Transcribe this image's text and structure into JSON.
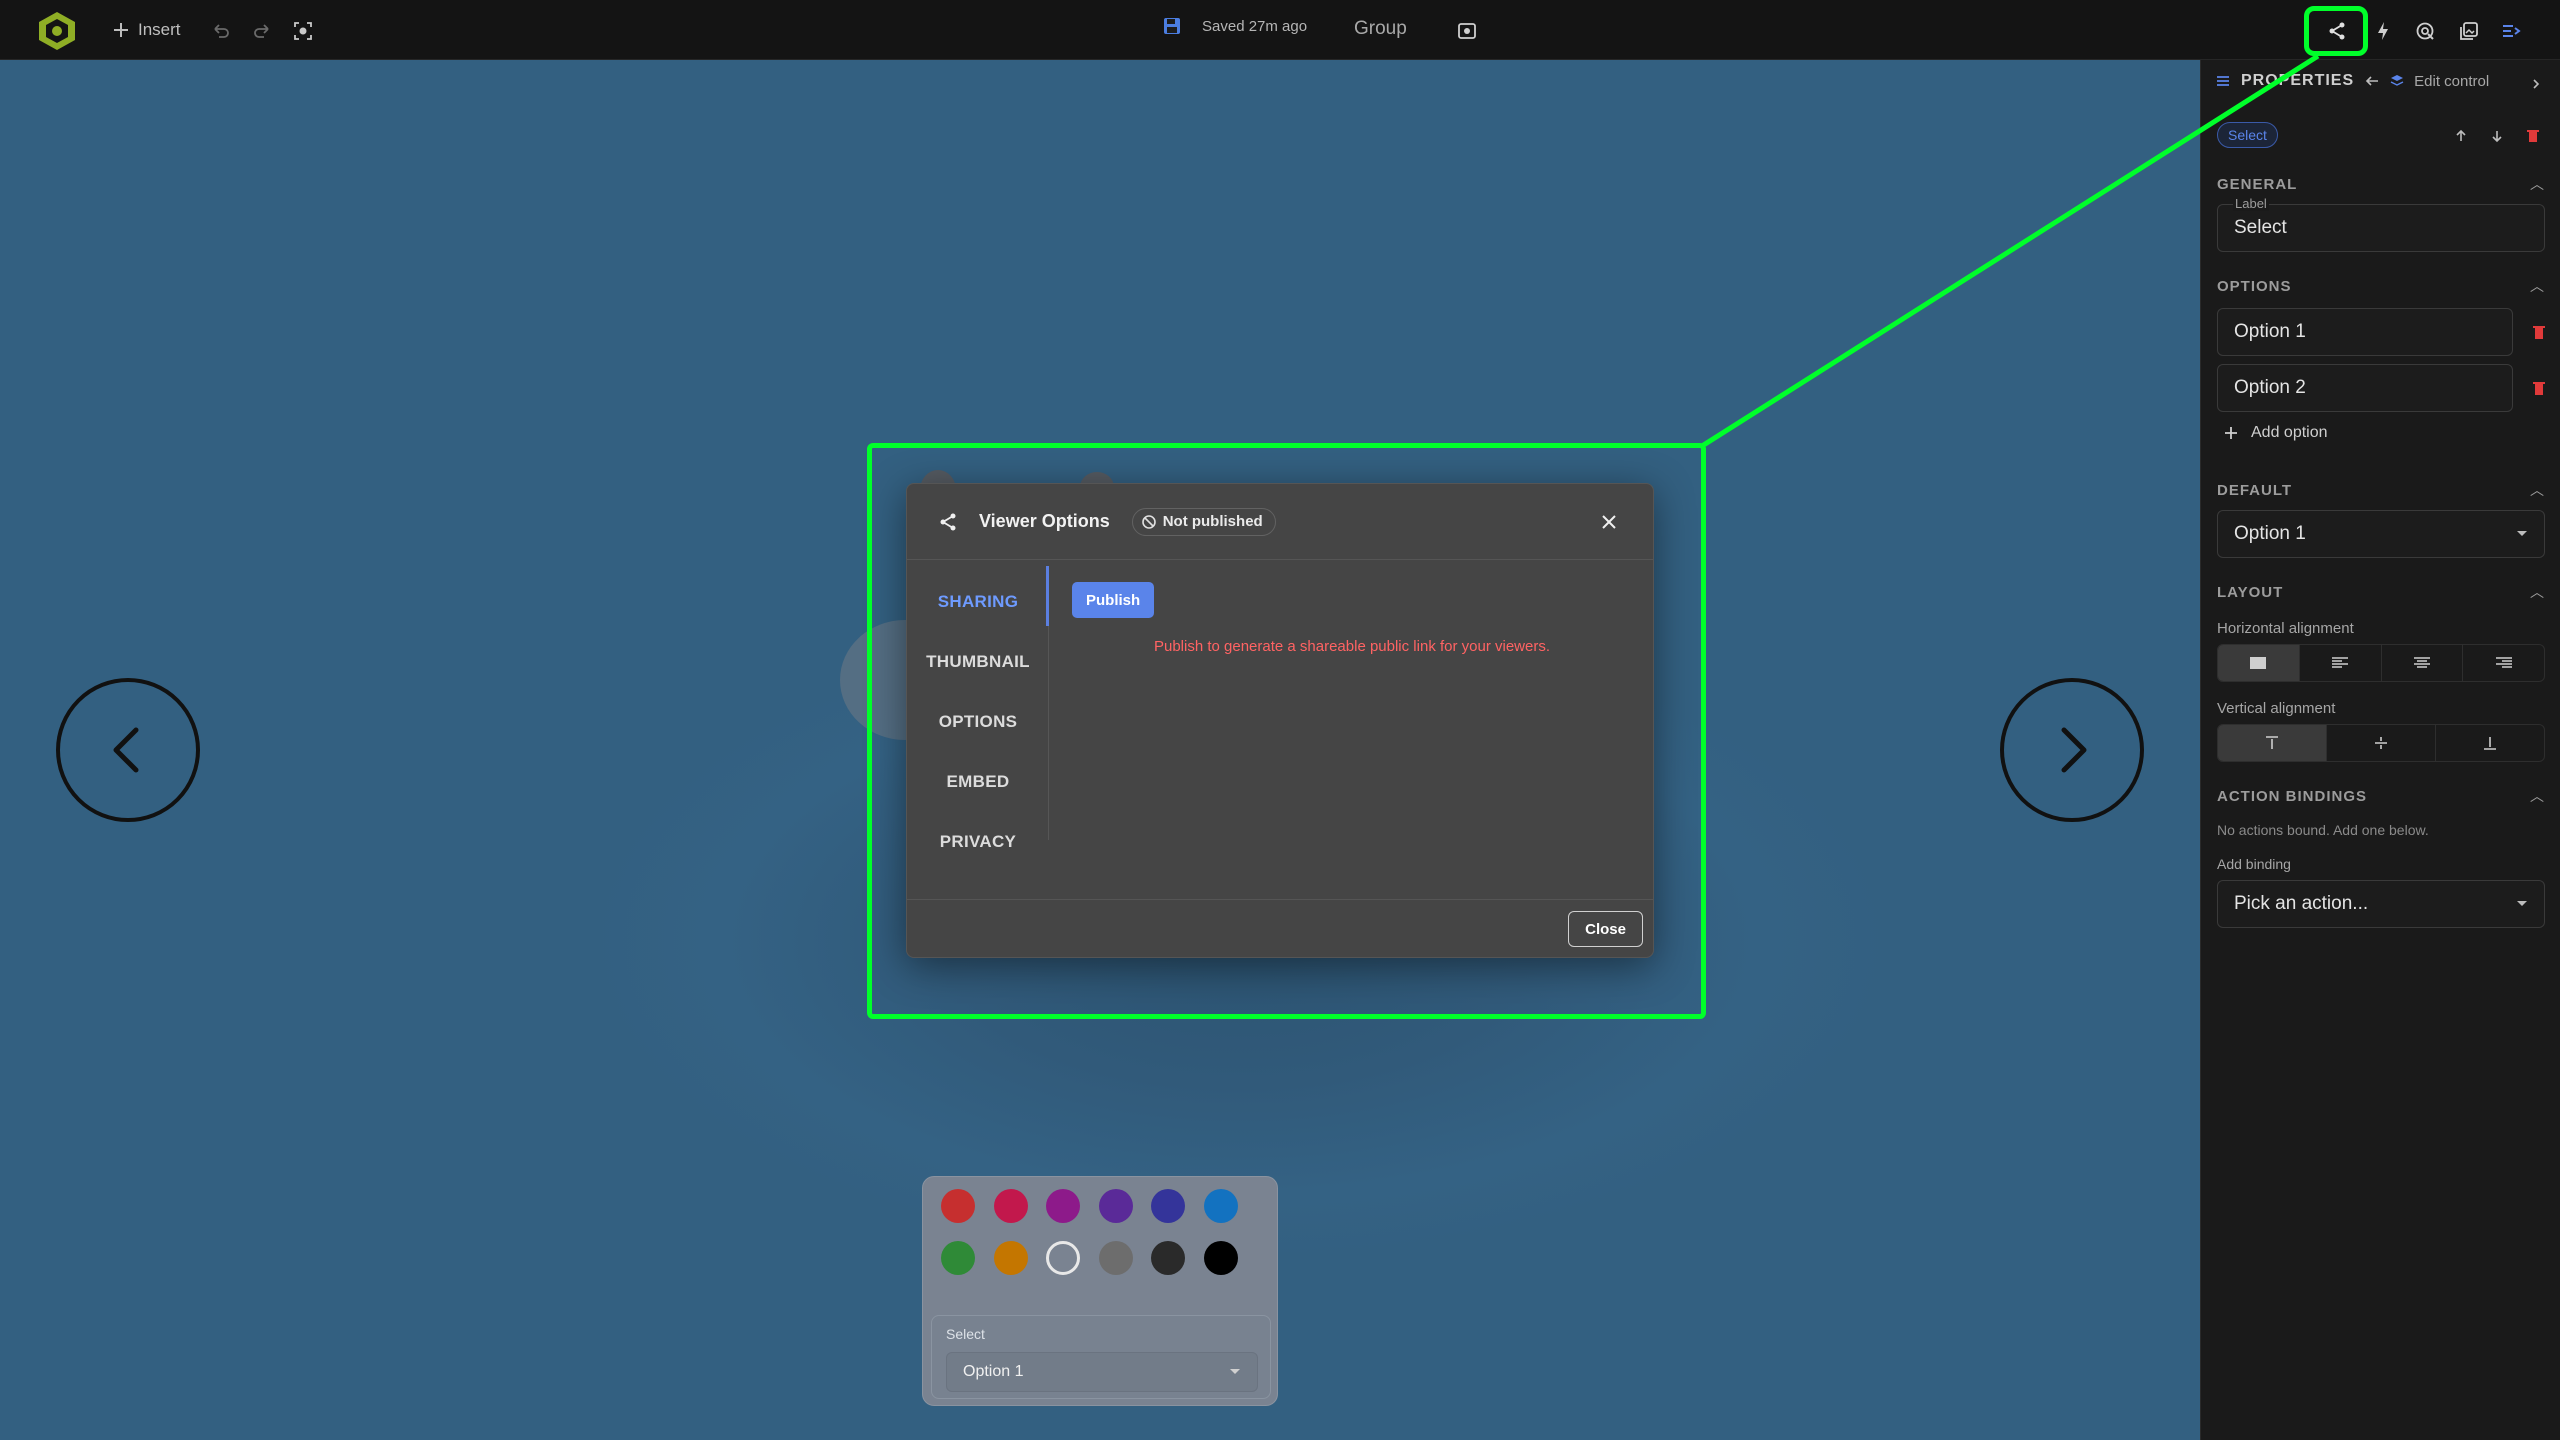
{
  "toolbar": {
    "insert_label": "Insert",
    "saved_text": "Saved 27m ago",
    "group_label": "Group"
  },
  "dialog": {
    "title": "Viewer Options",
    "status_badge": "Not published",
    "tabs": [
      "SHARING",
      "THUMBNAIL",
      "OPTIONS",
      "EMBED",
      "PRIVACY"
    ],
    "active_tab": "SHARING",
    "publish_label": "Publish",
    "publish_message": "Publish to generate a shareable public link for your viewers.",
    "close_label": "Close"
  },
  "palette": {
    "colors": [
      "#c62f2f",
      "#c2184c",
      "#8d1a8a",
      "#5a2a98",
      "#34349a",
      "#1372c0",
      "#2f8a37",
      "#c47600",
      "#ffffff",
      "#6d6d6d",
      "#2a2a2a",
      "#000000"
    ],
    "select_label": "Select",
    "select_value": "Option 1"
  },
  "panel": {
    "title": "PROPERTIES",
    "edit_label": "Edit control",
    "chip": "Select",
    "general": {
      "heading": "GENERAL",
      "label_caption": "Label",
      "label_value": "Select"
    },
    "options": {
      "heading": "OPTIONS",
      "items": [
        "Option 1",
        "Option 2"
      ],
      "add_label": "Add option"
    },
    "default": {
      "heading": "DEFAULT",
      "value": "Option 1"
    },
    "layout": {
      "heading": "LAYOUT",
      "horizontal_label": "Horizontal alignment",
      "vertical_label": "Vertical alignment"
    },
    "actions": {
      "heading": "ACTION BINDINGS",
      "empty_text": "No actions bound. Add one below.",
      "add_label": "Add binding",
      "placeholder": "Pick an action..."
    }
  },
  "highlight_color": "#00ff2a",
  "accent_color": "#5a84ea"
}
